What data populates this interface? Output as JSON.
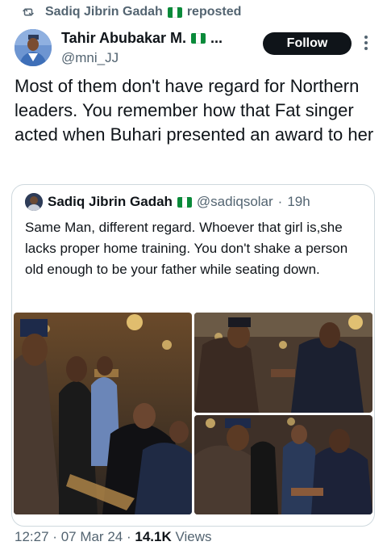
{
  "repost": {
    "label": "Sadiq Jibrin Gadah",
    "suffix": "reposted",
    "icon": "repost-icon"
  },
  "tweet": {
    "author_name": "Tahir Abubakar M.",
    "author_truncation": "...",
    "author_handle": "@mni_JJ",
    "follow_label": "Follow",
    "text": "Most of them don't have regard for Northern leaders. You remember how that Fat singer acted when Buhari presented an award to her"
  },
  "quoted": {
    "author_name": "Sadiq Jibrin Gadah",
    "author_handle": "@sadiqsolar",
    "separator": "·",
    "time": "19h",
    "text": "Same Man, different regard. Whoever that girl is,she lacks proper home training. You don't shake a person old enough to be your father while seating down."
  },
  "footer": {
    "time": "12:27",
    "separator": "·",
    "date": "07 Mar 24",
    "views_count": "14.1K",
    "views_label": "Views"
  },
  "colors": {
    "text_primary": "#0f1419",
    "text_secondary": "#536471",
    "border": "#cfd9de",
    "flag_green": "#0a8a3a"
  }
}
